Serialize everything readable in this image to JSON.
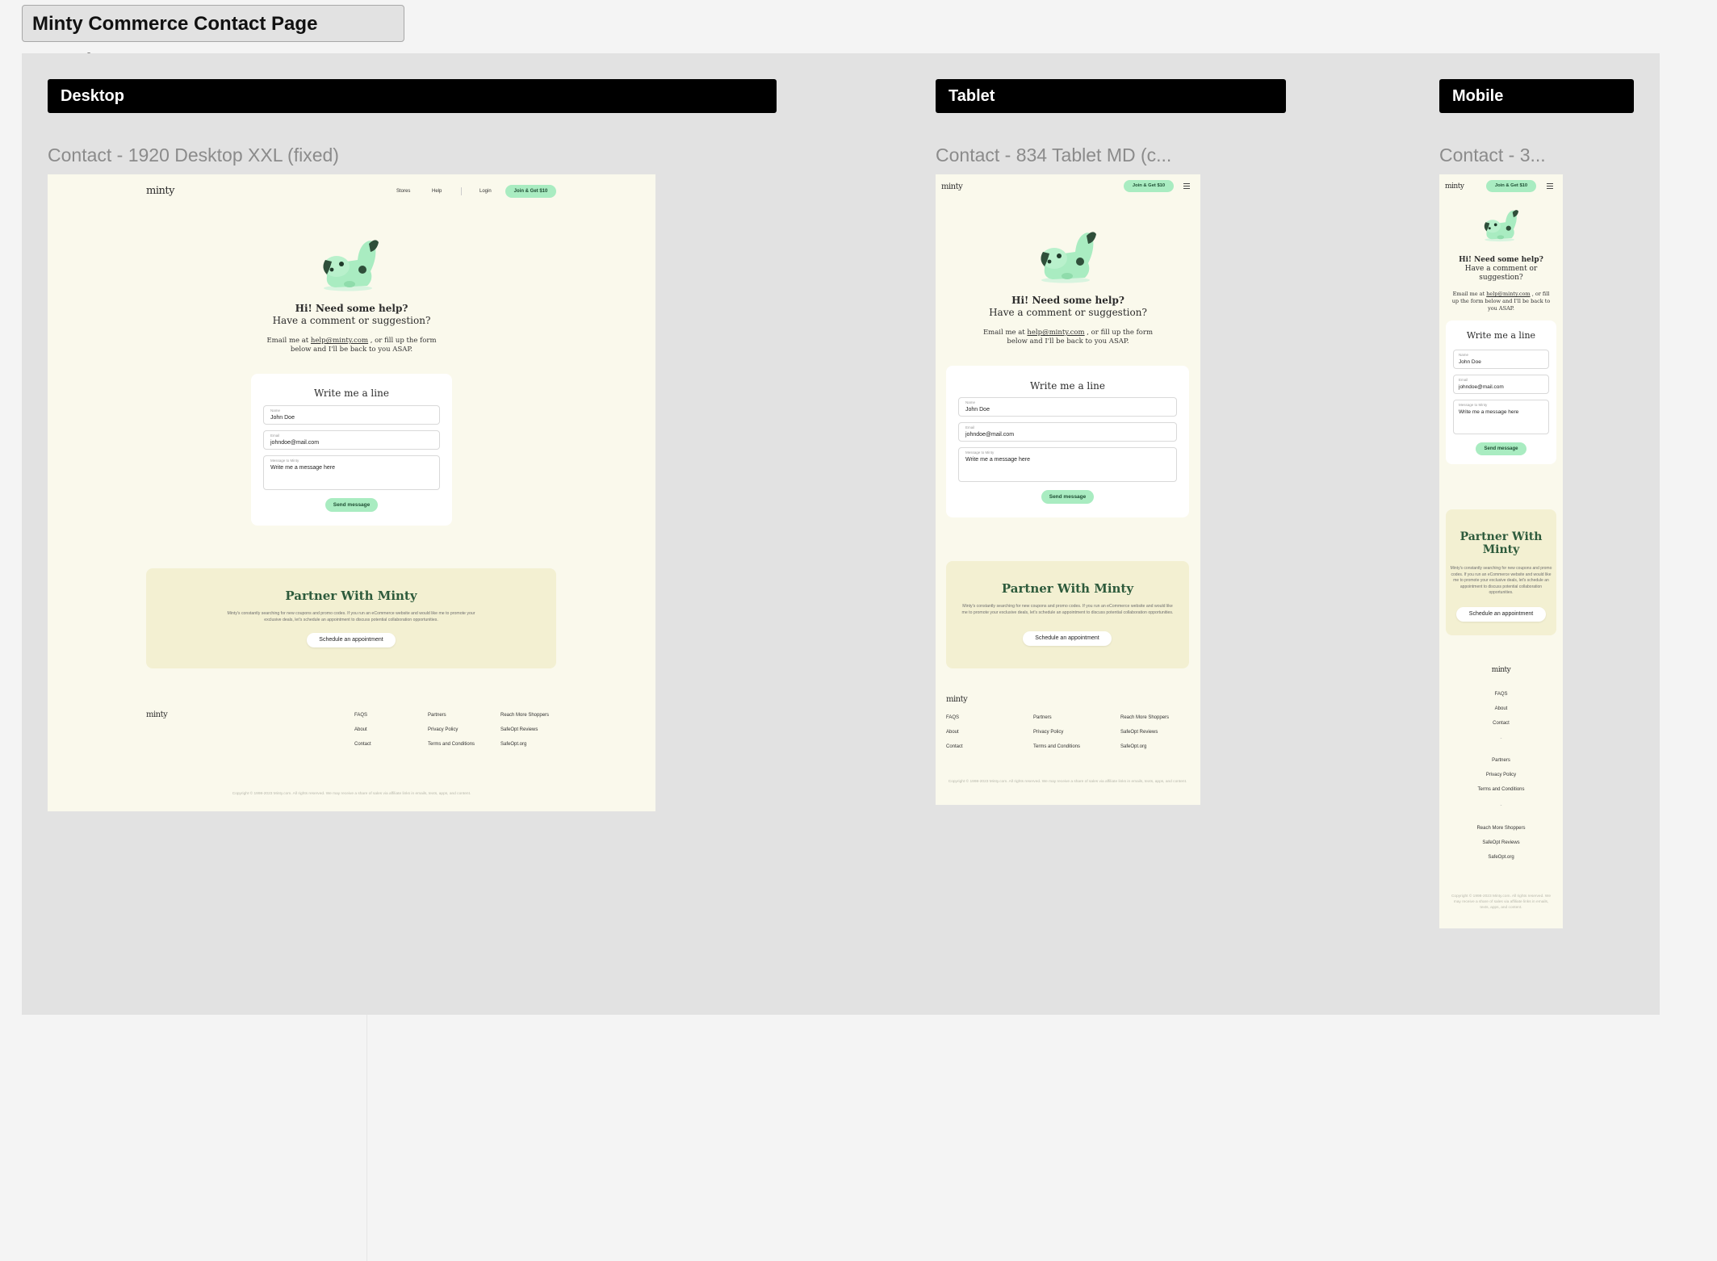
{
  "page_title": "Minty Commerce Contact Page Experience",
  "sections": {
    "desktop": {
      "header": "Desktop",
      "frame_label": "Contact - 1920 Desktop XXL (fixed)"
    },
    "tablet": {
      "header": "Tablet",
      "frame_label": "Contact - 834 Tablet MD (c..."
    },
    "mobile": {
      "header": "Mobile",
      "frame_label": "Contact - 3..."
    }
  },
  "site": {
    "logo": "minty",
    "nav": {
      "stores": "Stores",
      "help": "Help",
      "login": "Login",
      "join": "Join & Get $10"
    },
    "hero": {
      "headline": "Hi! Need some help?",
      "subheadline": "Have a comment or suggestion?",
      "email_prefix": "Email me at",
      "email": "help@minty.com",
      "email_suffix": ", or fill up the form below and I'll be back to you ASAP.",
      "email_suffix_line1": ", or fill up the form",
      "email_suffix_line2": "below and I'll be back to you ASAP."
    },
    "form": {
      "title": "Write me a line",
      "name_label": "Name",
      "name_value": "John Doe",
      "email_label": "Email",
      "email_value": "johndoe@mail.com",
      "message_label": "Message to Minty",
      "message_value": "Write me a message here",
      "submit": "Send message"
    },
    "partner": {
      "title": "Partner With Minty",
      "body": "Minty's constantly searching for new coupons and promo codes. If you run an eCommerce website and would like me to promote your exclusive deals, let's schedule an appointment to discuss potential collaboration opportunities.",
      "button": "Schedule an appointment"
    },
    "footer": {
      "col1": [
        "FAQS",
        "About",
        "Contact"
      ],
      "col2": [
        "Partners",
        "Privacy Policy",
        "Terms and Conditions"
      ],
      "col3": [
        "Reach More Shoppers",
        "SafeOpt Reviews",
        "SafeOpt.org"
      ],
      "separator": "-",
      "copyright": "Copyright © 1998-2023 Minty.com. All rights reserved. We may receive a share of sales via affiliate links in emails, texts, apps, and content."
    }
  },
  "colors": {
    "page_bg": "#faf9ec",
    "accent_green": "#a9ecc1",
    "partner_bg": "#f3f0d2",
    "partner_title": "#2e5b3c",
    "canvas": "#e2e2e2"
  }
}
